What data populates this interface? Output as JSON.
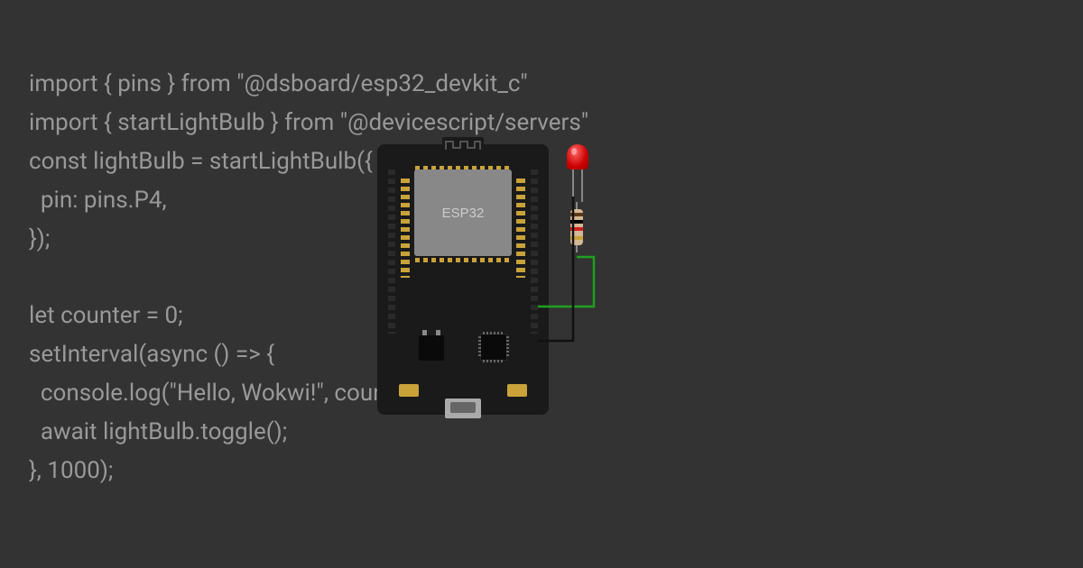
{
  "code": {
    "line1": "import { pins } from \"@dsboard/esp32_devkit_c\"",
    "line2": "import { startLightBulb } from \"@devicescript/servers\"",
    "line3": "const lightBulb = startLightBulb({",
    "line4": "  pin: pins.P4,",
    "line5": "});",
    "line6": "",
    "line7": "let counter = 0;",
    "line8": "setInterval(async () => {",
    "line9": "  console.log(\"Hello, Wokwi!\", counter++);",
    "line10": "  await lightBulb.toggle();",
    "line11": "}, 1000);"
  },
  "board": {
    "chip_label": "ESP32"
  },
  "components": {
    "led_color": "#cc0000",
    "wire_green": "#1fa01f",
    "wire_black": "#111111"
  }
}
